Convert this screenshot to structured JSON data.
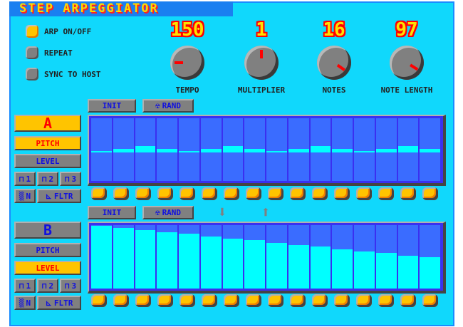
{
  "title": "STEP ARPEGGIATOR",
  "options": [
    {
      "label": "ARP ON/OFF",
      "on": true
    },
    {
      "label": "REPEAT",
      "on": false
    },
    {
      "label": "SYNC TO HOST",
      "on": false
    }
  ],
  "knobs": [
    {
      "label": "TEMPO",
      "value": "150",
      "angle": -90
    },
    {
      "label": "MULTIPLIER",
      "value": "1",
      "angle": 0
    },
    {
      "label": "NOTES",
      "value": "16",
      "angle": 125
    },
    {
      "label": "NOTE LENGTH",
      "value": "97",
      "angle": 122
    }
  ],
  "toolbar": {
    "init": "INIT",
    "rand": "RAND"
  },
  "lane_a": {
    "name": "A",
    "pitch": "PITCH",
    "level": "LEVEL",
    "wave1": "1",
    "wave2": "2",
    "wave3": "3",
    "noise": "N",
    "filter": "FLTR",
    "active_mode": "pitch",
    "pitch_values": [
      0,
      1,
      2,
      1,
      0,
      1,
      2,
      1,
      0,
      1,
      2,
      1,
      0,
      1,
      2,
      1
    ]
  },
  "lane_b": {
    "name": "B",
    "pitch": "PITCH",
    "level": "LEVEL",
    "wave1": "1",
    "wave2": "2",
    "wave3": "3",
    "noise": "N",
    "filter": "FLTR",
    "active_mode": "level",
    "level_values": [
      99,
      96,
      92,
      89,
      86,
      82,
      79,
      76,
      72,
      69,
      66,
      62,
      59,
      56,
      52,
      49
    ]
  },
  "colors": {
    "background": "#10d8fc",
    "accent": "#ffc400",
    "grid": "#3a6cff",
    "bar": "#00ffff"
  }
}
